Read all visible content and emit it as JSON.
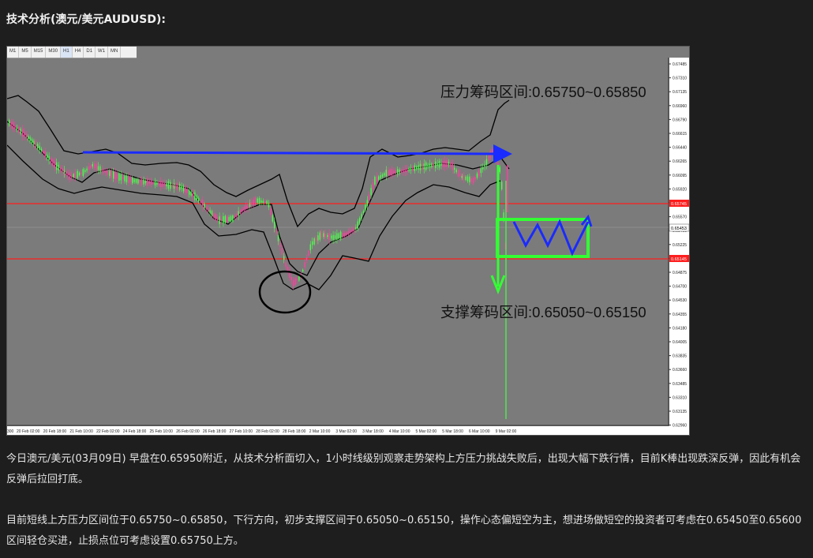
{
  "title": "技术分析(澳元/美元AUDUSD):",
  "chart": {
    "timeframes": [
      "M1",
      "M5",
      "M15",
      "M30",
      "H1",
      "H4",
      "D1",
      "W1",
      "MN"
    ],
    "active_timeframe": "H1",
    "resistance_label": "压力筹码区间:0.65750~0.65850",
    "support_label": "支撑筹码区间:0.65050~0.65150",
    "price_ticks": [
      "0.67485",
      "0.67310",
      "0.67135",
      "0.66960",
      "0.66790",
      "0.66615",
      "0.66440",
      "0.66265",
      "0.66095",
      "0.65920",
      "0.65745",
      "0.65570",
      "0.65400",
      "0.65225",
      "0.65050",
      "0.64875",
      "0.64700",
      "0.64530",
      "0.64355",
      "0.64180",
      "0.64005",
      "0.63835",
      "0.63660",
      "0.63485",
      "0.63310",
      "0.63135",
      "0.62960"
    ],
    "current_price": "0.65453",
    "red_line_upper_price": "0.65745",
    "red_line_lower_price": "0.65145",
    "time_ticks": [
      "300",
      "20 Feb 02:00",
      "20 Feb 18:00",
      "21 Feb 10:00",
      "22 Feb 02:00",
      "24 Feb 18:00",
      "25 Feb 10:00",
      "26 Feb 02:00",
      "26 Feb 18:00",
      "27 Feb 10:00",
      "28 Feb 02:00",
      "28 Feb 18:00",
      "2 Mar 10:00",
      "3 Mar 02:00",
      "3 Mar 18:00",
      "4 Mar 10:00",
      "5 Mar 02:00",
      "5 Mar 18:00",
      "6 Mar 10:00",
      "9 Mar 02:00"
    ],
    "colors": {
      "background": "#7b7b7b",
      "bull_candle": "#4cff4c",
      "bear_candle": "#ff3fa0",
      "bands": "#000000",
      "red_lines": "#ff1e1e",
      "blue_arrow": "#1a2bff",
      "green_annotation": "#33ff33",
      "circle": "#000000"
    }
  },
  "paragraphs": [
    "今日澳元/美元(03月09日) 早盘在0.65950附近，从技术分析面切入，1小时线级别观察走势架构上方压力挑战失败后，出现大幅下跌行情，目前K棒出现跌深反弹，因此有机会反弹后拉回打底。",
    "目前短线上方压力区间位于0.65750~0.65850，下行方向，初步支撑区间于0.65050~0.65150，操作心态偏短空为主，想进场做短空的投资者可考虑在0.65450至0.65600区间轻仓买进，止损点位可考虑设置0.65750上方。"
  ]
}
